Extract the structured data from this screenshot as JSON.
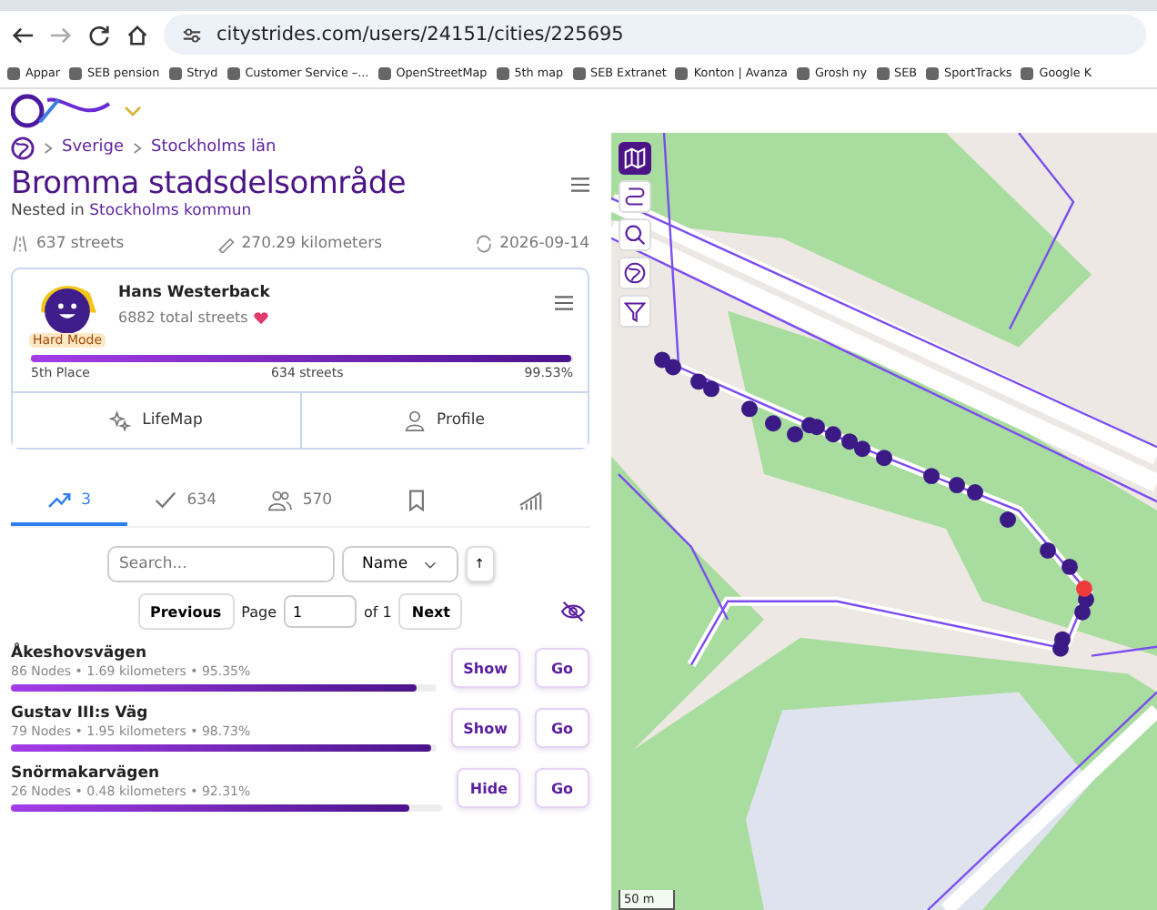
{
  "browser": {
    "url": "citystrides.com/users/24151/cities/225695",
    "bookmarks": [
      "Appar",
      "SEB pension",
      "Stryd",
      "Customer Service –...",
      "OpenStreetMap",
      "5th map",
      "SEB Extranet",
      "Konton | Avanza",
      "Grosh ny",
      "SEB",
      "SportTracks",
      "Google K"
    ]
  },
  "breadcrumb": [
    "Sverige",
    "Stockholms län"
  ],
  "city": {
    "title": "Bromma stadsdelsområde",
    "nested_prefix": "Nested in",
    "nested_link": "Stockholms kommun",
    "streets": "637 streets",
    "distance": "270.29 kilometers",
    "updated": "2026-09-14"
  },
  "user_card": {
    "name": "Hans Westerback",
    "total": "6882 total streets",
    "badge": "Hard Mode",
    "level": 0.9953,
    "place": "5th Place",
    "streets": "634 streets",
    "percent": "99.53%",
    "buttons": [
      "LifeMap",
      "Profile"
    ]
  },
  "tabs": [
    {
      "kind": "trend",
      "label": "3",
      "selected": true
    },
    {
      "kind": "check",
      "label": "634",
      "selected": false
    },
    {
      "kind": "people",
      "label": "570",
      "selected": false
    },
    {
      "kind": "bookmark",
      "selected": false
    },
    {
      "kind": "chart",
      "selected": false
    }
  ],
  "filter": {
    "placeholder": "Search...",
    "sort": "Name",
    "order": "↑"
  },
  "pager": {
    "previous": "Previous",
    "page_label": "Page",
    "page": "1",
    "of": "of 1",
    "next": "Next"
  },
  "streets": [
    {
      "name": "Åkeshovsvägen",
      "stats": "86 Nodes • 1.69 kilometers • 95.35%",
      "level": 0.9535,
      "toggle": "Show",
      "go": "Go"
    },
    {
      "name": "Gustav III:s Väg",
      "stats": "79 Nodes • 1.95 kilometers • 98.73%",
      "level": 0.9873,
      "toggle": "Show",
      "go": "Go"
    },
    {
      "name": "Snörmakarvägen",
      "stats": "26 Nodes • 0.48 kilometers • 92.31%",
      "level": 0.9231,
      "toggle": "Hide",
      "go": "Go"
    }
  ],
  "map": {
    "tools": [
      {
        "kind": "map",
        "selected": true
      },
      {
        "kind": "route",
        "selected": false
      },
      {
        "kind": "search",
        "selected": false
      },
      {
        "kind": "globe",
        "selected": false
      },
      {
        "kind": "filter",
        "selected": false
      }
    ],
    "scale": "50 m"
  }
}
